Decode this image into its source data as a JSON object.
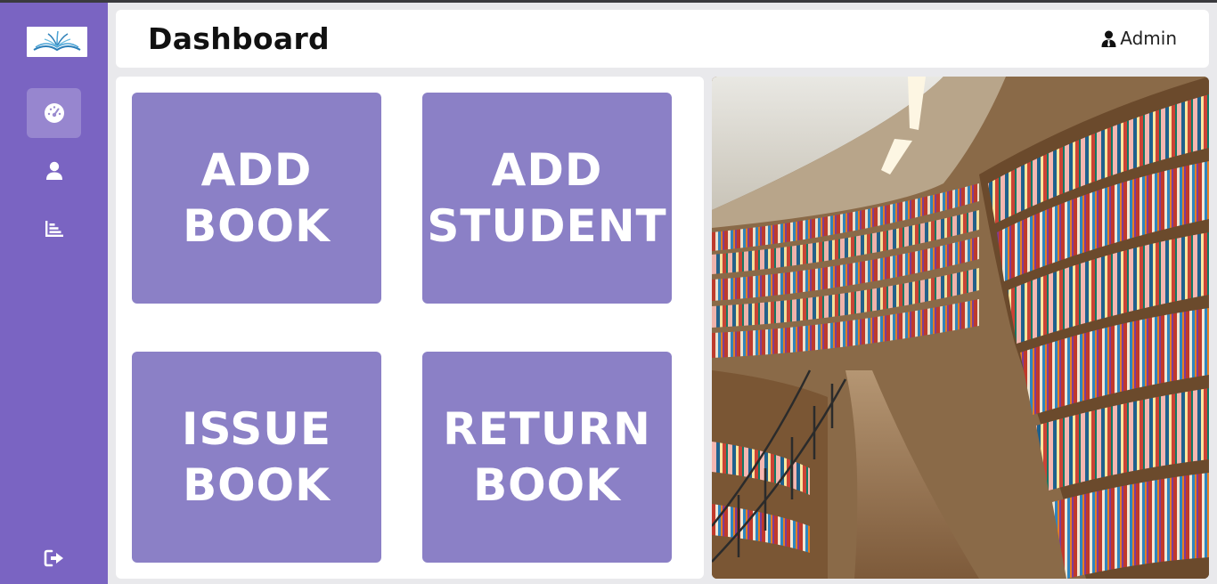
{
  "header": {
    "title": "Dashboard",
    "user_label": "Admin"
  },
  "sidebar": {
    "items": [
      {
        "icon": "dashboard-gauge-icon",
        "active": true
      },
      {
        "icon": "user-icon",
        "active": false
      },
      {
        "icon": "bar-chart-icon",
        "active": false
      }
    ],
    "logout_icon": "sign-out-icon"
  },
  "tiles": [
    {
      "line1": "ADD",
      "line2": "BOOK"
    },
    {
      "line1": "ADD",
      "line2": "STUDENT"
    },
    {
      "line1": "ISSUE",
      "line2": "BOOK"
    },
    {
      "line1": "RETURN",
      "line2": "BOOK"
    }
  ],
  "colors": {
    "sidebar": "#7a64c2",
    "tile": "#8b80c6",
    "background": "#e9e9ec"
  }
}
